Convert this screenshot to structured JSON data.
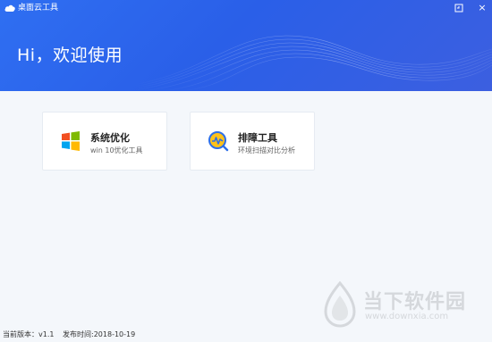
{
  "window": {
    "title": "桌面云工具",
    "feedback_icon": "feedback-icon",
    "close_label": "×"
  },
  "header": {
    "greeting": "Hi，欢迎使用"
  },
  "cards": [
    {
      "title": "系统优化",
      "subtitle": "win 10优化工具",
      "icon": "windows-logo-icon"
    },
    {
      "title": "排障工具",
      "subtitle": "环境扫描对比分析",
      "icon": "chart-magnifier-icon"
    }
  ],
  "footer": {
    "version": "当前版本：v1.1",
    "release": "发布时间:2018-10-19"
  },
  "watermark": {
    "text": "当下软件园",
    "url": "www.downxia.com"
  },
  "colors": {
    "header_blue": "#2f6ff2",
    "background": "#f4f7fb"
  }
}
